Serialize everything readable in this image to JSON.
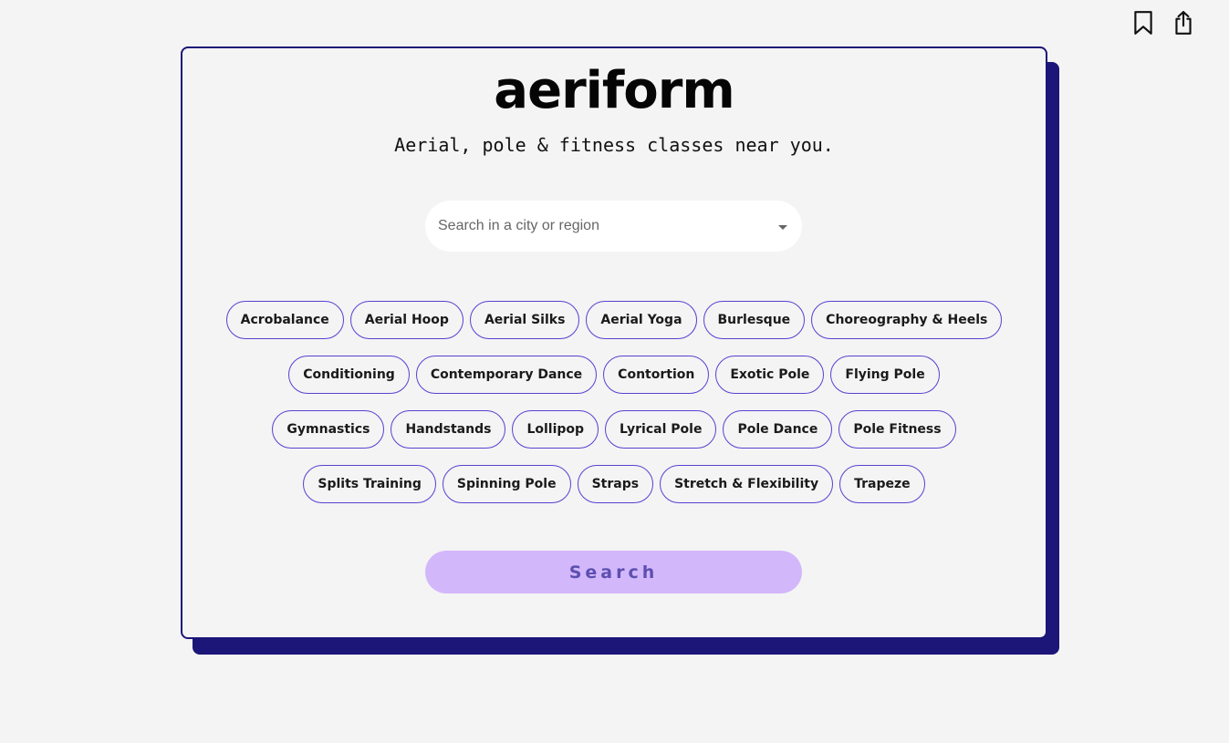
{
  "app": {
    "logo": "aeriform",
    "tagline": "Aerial, pole & fitness classes near you."
  },
  "top_actions": {
    "icons": [
      "bookmark-icon",
      "share-icon"
    ]
  },
  "search": {
    "placeholder": "Search in a city or region",
    "value": "",
    "dropdown_icon": "chevron-down-icon",
    "button_label": "Search"
  },
  "tags": {
    "rows": [
      [
        "Acrobalance",
        "Aerial Hoop",
        "Aerial Silks",
        "Aerial Yoga",
        "Burlesque",
        "Choreography & Heels"
      ],
      [
        "Conditioning",
        "Contemporary Dance",
        "Contortion",
        "Exotic Pole",
        "Flying Pole"
      ],
      [
        "Gymnastics",
        "Handstands",
        "Lollipop",
        "Lyrical Pole",
        "Pole Dance",
        "Pole Fitness"
      ],
      [
        "Splits Training",
        "Spinning Pole",
        "Straps",
        "Stretch & Flexibility",
        "Trapeze"
      ]
    ]
  },
  "colors": {
    "accent": "#1c1678",
    "tag_border": "#5b3fd1",
    "button_bg": "#d2b7fb",
    "button_text": "#5d4fb0",
    "background": "#f4f4f4"
  }
}
